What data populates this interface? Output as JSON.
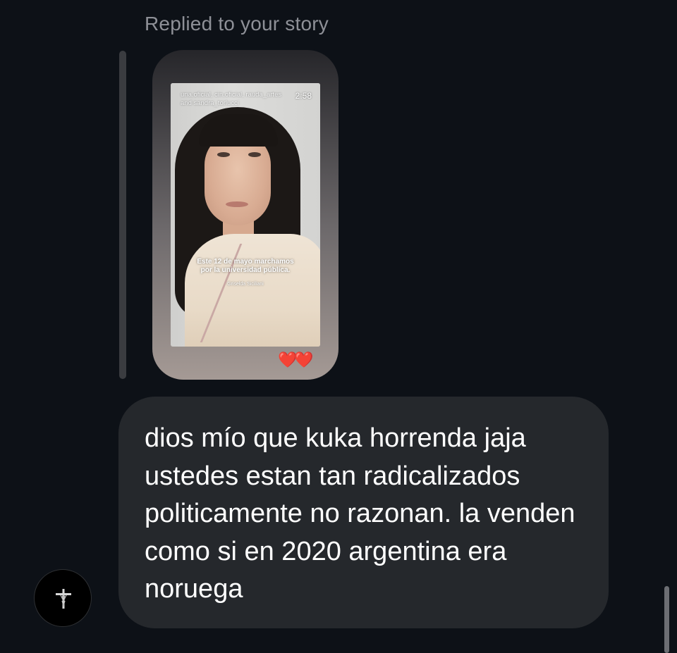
{
  "reply_header": {
    "label": "Replied to your story"
  },
  "story": {
    "tagged_text": "una.oficial, cin.oficial, rauda_artes and sandra_torlucci",
    "timer": "2:58",
    "caption_line1": "Este 12 de mayo marchamos",
    "caption_line2": "por la universidad pública.",
    "caption_author": "Griselda Siciliani",
    "reaction": "❤️❤️"
  },
  "message": {
    "text": "dios mío que kuka horrenda jaja ustedes estan tan radicalizados politicamente no razonan. la venden como si en 2020 argentina era noruega"
  },
  "avatar": {
    "icon": "crucifix-icon"
  },
  "colors": {
    "background": "#0d1117",
    "bubble": "#25282c",
    "muted_text": "#8e9097",
    "heart": "#e0241f"
  }
}
